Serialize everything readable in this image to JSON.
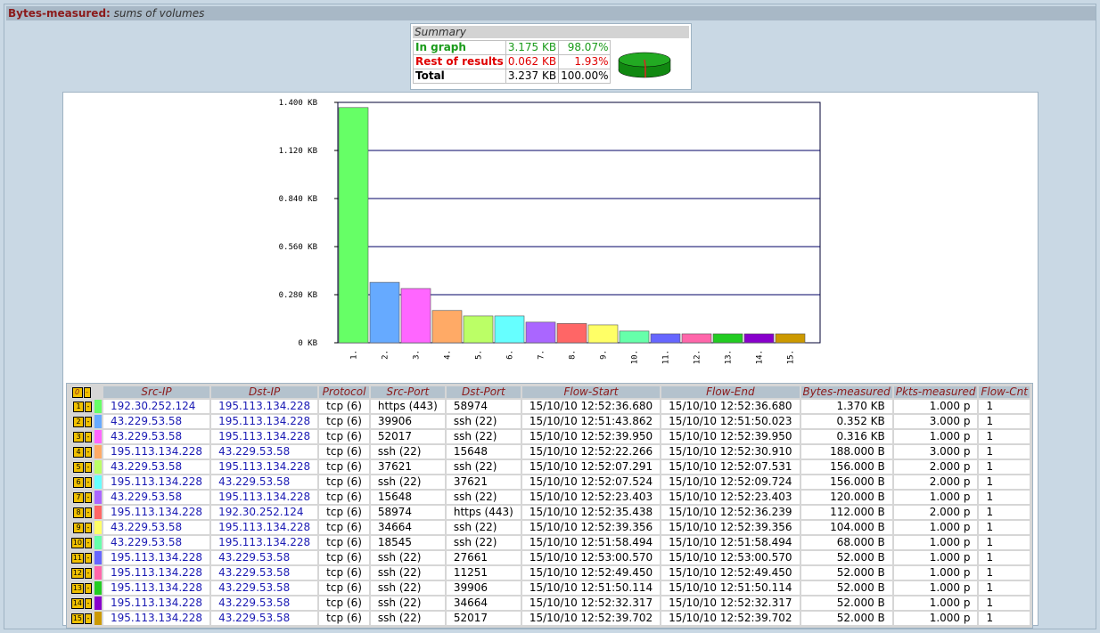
{
  "title": {
    "name": "Bytes-measured:",
    "subtitle": "sums of volumes"
  },
  "summary": {
    "header": "Summary",
    "rows": [
      {
        "label": "In graph",
        "value": "3.175 KB",
        "pct": "98.07%"
      },
      {
        "label": "Rest of results",
        "value": "0.062 KB",
        "pct": "1.93%"
      },
      {
        "label": "Total",
        "value": "3.237 KB",
        "pct": "100.00%"
      }
    ],
    "pie_colors": {
      "in_graph": "#22aa22",
      "rest": "#dd2222"
    }
  },
  "chart_data": {
    "type": "bar",
    "categories": [
      "1.",
      "2.",
      "3.",
      "4.",
      "5.",
      "6.",
      "7.",
      "8.",
      "9.",
      "10.",
      "11.",
      "12.",
      "13.",
      "14.",
      "15."
    ],
    "values": [
      1.37,
      0.352,
      0.316,
      0.188,
      0.156,
      0.156,
      0.12,
      0.112,
      0.104,
      0.068,
      0.052,
      0.052,
      0.052,
      0.052,
      0.052
    ],
    "unit": "KB",
    "ylim": [
      0,
      1.4
    ],
    "yticks": [
      0,
      0.28,
      0.56,
      0.84,
      1.12,
      1.4
    ],
    "ytick_labels": [
      "0 KB",
      "0.280 KB",
      "0.560 KB",
      "0.840 KB",
      "1.120 KB",
      "1.400 KB"
    ],
    "colors": [
      "#66ff66",
      "#66aaff",
      "#ff66ff",
      "#ffaa66",
      "#bbff66",
      "#66ffff",
      "#aa66ff",
      "#ff6666",
      "#ffff66",
      "#66ffaa",
      "#6666ff",
      "#ff66aa",
      "#22cc22",
      "#8800cc",
      "#cc9900"
    ],
    "grid": true,
    "title": "",
    "xlabel": "",
    "ylabel": ""
  },
  "table": {
    "header_ctl": "0",
    "columns": [
      "Src-IP",
      "Dst-IP",
      "Protocol",
      "Src-Port",
      "Dst-Port",
      "Flow-Start",
      "Flow-End",
      "Bytes-measured",
      "Pkts-measured",
      "Flow-Cnt"
    ],
    "rows": [
      [
        "192.30.252.124",
        "195.113.134.228",
        "tcp (6)",
        "https (443)",
        "58974",
        "15/10/10 12:52:36.680",
        "15/10/10 12:52:36.680",
        "1.370 KB",
        "1.000 p",
        "1"
      ],
      [
        "43.229.53.58",
        "195.113.134.228",
        "tcp (6)",
        "39906",
        "ssh (22)",
        "15/10/10 12:51:43.862",
        "15/10/10 12:51:50.023",
        "0.352 KB",
        "3.000 p",
        "1"
      ],
      [
        "43.229.53.58",
        "195.113.134.228",
        "tcp (6)",
        "52017",
        "ssh (22)",
        "15/10/10 12:52:39.950",
        "15/10/10 12:52:39.950",
        "0.316 KB",
        "1.000 p",
        "1"
      ],
      [
        "195.113.134.228",
        "43.229.53.58",
        "tcp (6)",
        "ssh (22)",
        "15648",
        "15/10/10 12:52:22.266",
        "15/10/10 12:52:30.910",
        "188.000 B",
        "3.000 p",
        "1"
      ],
      [
        "43.229.53.58",
        "195.113.134.228",
        "tcp (6)",
        "37621",
        "ssh (22)",
        "15/10/10 12:52:07.291",
        "15/10/10 12:52:07.531",
        "156.000 B",
        "2.000 p",
        "1"
      ],
      [
        "195.113.134.228",
        "43.229.53.58",
        "tcp (6)",
        "ssh (22)",
        "37621",
        "15/10/10 12:52:07.524",
        "15/10/10 12:52:09.724",
        "156.000 B",
        "2.000 p",
        "1"
      ],
      [
        "43.229.53.58",
        "195.113.134.228",
        "tcp (6)",
        "15648",
        "ssh (22)",
        "15/10/10 12:52:23.403",
        "15/10/10 12:52:23.403",
        "120.000 B",
        "1.000 p",
        "1"
      ],
      [
        "195.113.134.228",
        "192.30.252.124",
        "tcp (6)",
        "58974",
        "https (443)",
        "15/10/10 12:52:35.438",
        "15/10/10 12:52:36.239",
        "112.000 B",
        "2.000 p",
        "1"
      ],
      [
        "43.229.53.58",
        "195.113.134.228",
        "tcp (6)",
        "34664",
        "ssh (22)",
        "15/10/10 12:52:39.356",
        "15/10/10 12:52:39.356",
        "104.000 B",
        "1.000 p",
        "1"
      ],
      [
        "43.229.53.58",
        "195.113.134.228",
        "tcp (6)",
        "18545",
        "ssh (22)",
        "15/10/10 12:51:58.494",
        "15/10/10 12:51:58.494",
        "68.000 B",
        "1.000 p",
        "1"
      ],
      [
        "195.113.134.228",
        "43.229.53.58",
        "tcp (6)",
        "ssh (22)",
        "27661",
        "15/10/10 12:53:00.570",
        "15/10/10 12:53:00.570",
        "52.000 B",
        "1.000 p",
        "1"
      ],
      [
        "195.113.134.228",
        "43.229.53.58",
        "tcp (6)",
        "ssh (22)",
        "11251",
        "15/10/10 12:52:49.450",
        "15/10/10 12:52:49.450",
        "52.000 B",
        "1.000 p",
        "1"
      ],
      [
        "195.113.134.228",
        "43.229.53.58",
        "tcp (6)",
        "ssh (22)",
        "39906",
        "15/10/10 12:51:50.114",
        "15/10/10 12:51:50.114",
        "52.000 B",
        "1.000 p",
        "1"
      ],
      [
        "195.113.134.228",
        "43.229.53.58",
        "tcp (6)",
        "ssh (22)",
        "34664",
        "15/10/10 12:52:32.317",
        "15/10/10 12:52:32.317",
        "52.000 B",
        "1.000 p",
        "1"
      ],
      [
        "195.113.134.228",
        "43.229.53.58",
        "tcp (6)",
        "ssh (22)",
        "52017",
        "15/10/10 12:52:39.702",
        "15/10/10 12:52:39.702",
        "52.000 B",
        "1.000 p",
        "1"
      ]
    ],
    "row_buttons": [
      "1",
      "2",
      "3",
      "4",
      "5",
      "6",
      "7",
      "8",
      "9",
      "10",
      "11",
      "12",
      "13",
      "14",
      "15"
    ],
    "minus_label": "-"
  }
}
